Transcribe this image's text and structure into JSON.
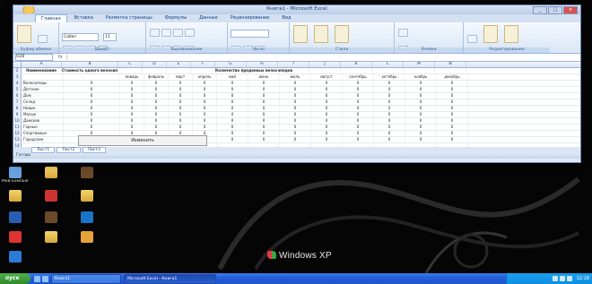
{
  "excel": {
    "title": "Книга1 - Microsoft Excel",
    "tabs": [
      "Главная",
      "Вставка",
      "Разметка страницы",
      "Формулы",
      "Данные",
      "Рецензирование",
      "Вид"
    ],
    "ribbon_groups": [
      "Буфер обмена",
      "Шрифт",
      "Выравнивание",
      "Число",
      "Стили",
      "Ячейки",
      "Редактирование"
    ],
    "font_name": "Calibri",
    "font_size": "11",
    "name_box": "O28",
    "fx": "fx",
    "columns": [
      "A",
      "B",
      "C",
      "D",
      "E",
      "F",
      "G",
      "H",
      "I",
      "J",
      "K",
      "L",
      "M",
      "N"
    ],
    "header_row": {
      "col_a": "Наименование",
      "col_b": "Стоимость одного велосипеда",
      "col_g": "Количество проданных велосипедов"
    },
    "subheaders": [
      "январь",
      "февраль",
      "март",
      "апрель",
      "май",
      "июнь",
      "июль",
      "август",
      "сентябрь",
      "октябрь",
      "ноябрь",
      "декабрь"
    ],
    "rows": [
      {
        "n": "2",
        "name": "",
        "cells": []
      },
      {
        "n": "3",
        "name": "Наименование",
        "cells": []
      },
      {
        "n": "4",
        "name": "Велосипеды",
        "cells": [
          "0",
          "0",
          "0",
          "0",
          "0",
          "0",
          "0",
          "0",
          "0",
          "0",
          "0",
          "0",
          "0"
        ]
      },
      {
        "n": "5",
        "name": "Детские",
        "cells": [
          "0",
          "0",
          "0",
          "0",
          "0",
          "0",
          "0",
          "0",
          "0",
          "0",
          "0",
          "0",
          "0"
        ]
      },
      {
        "n": "6",
        "name": "Дом",
        "cells": [
          "0",
          "0",
          "0",
          "0",
          "0",
          "0",
          "0",
          "0",
          "0",
          "0",
          "0",
          "0",
          "0"
        ]
      },
      {
        "n": "7",
        "name": "Склад",
        "cells": [
          "0",
          "0",
          "0",
          "0",
          "0",
          "0",
          "0",
          "0",
          "0",
          "0",
          "0",
          "0",
          "0"
        ]
      },
      {
        "n": "8",
        "name": "Новые",
        "cells": [
          "0",
          "0",
          "0",
          "0",
          "0",
          "0",
          "0",
          "0",
          "0",
          "0",
          "0",
          "0",
          "0"
        ]
      },
      {
        "n": "9",
        "name": "Малые",
        "cells": [
          "0",
          "0",
          "0",
          "0",
          "0",
          "0",
          "0",
          "0",
          "0",
          "0",
          "0",
          "0",
          "0"
        ]
      },
      {
        "n": "10",
        "name": "Дамские",
        "cells": [
          "0",
          "0",
          "0",
          "0",
          "0",
          "0",
          "0",
          "0",
          "0",
          "0",
          "0",
          "0",
          "0"
        ]
      },
      {
        "n": "11",
        "name": "Горные",
        "cells": [
          "0",
          "0",
          "0",
          "0",
          "0",
          "0",
          "0",
          "0",
          "0",
          "0",
          "0",
          "0",
          "0"
        ]
      },
      {
        "n": "12",
        "name": "Спортивные",
        "cells": [
          "0",
          "0",
          "0",
          "0",
          "0",
          "0",
          "0",
          "0",
          "0",
          "0",
          "0",
          "0",
          "0"
        ]
      },
      {
        "n": "13",
        "name": "Городские",
        "cells": [
          "0",
          "0",
          "0",
          "0",
          "0",
          "0",
          "0",
          "0",
          "0",
          "0",
          "0",
          "0",
          "0"
        ]
      },
      {
        "n": "14",
        "name": "",
        "cells": []
      },
      {
        "n": "15",
        "name": "",
        "cells": []
      },
      {
        "n": "16",
        "name": "",
        "cells": []
      },
      {
        "n": "17",
        "name": "",
        "cells": []
      }
    ],
    "popup": "Изменить",
    "sheet_tabs": [
      "Лист1",
      "Лист2",
      "Лист3"
    ],
    "status": "Готово"
  },
  "desktop_icons": [
    {
      "label": "Мой компьютер",
      "color": "#6aa0e0"
    },
    {
      "label": "",
      "color": "folder"
    },
    {
      "label": "",
      "color": "#6b4a2a"
    },
    {
      "label": "",
      "color": "folder"
    },
    {
      "label": "",
      "color": "#c33"
    },
    {
      "label": "",
      "color": "folder"
    },
    {
      "label": "",
      "color": "#2a5db0"
    },
    {
      "label": "",
      "color": "#6b4a2a"
    },
    {
      "label": "",
      "color": "#1a73c9"
    },
    {
      "label": "",
      "color": "#d33"
    },
    {
      "label": "",
      "color": "folder"
    },
    {
      "label": "",
      "color": "#e8a23a"
    },
    {
      "label": "",
      "color": "#2b7bd8"
    }
  ],
  "xp_label": "Windows XP",
  "taskbar": {
    "start": "пуск",
    "buttons": [
      "Книга1",
      "Microsoft Excel - Книга1"
    ],
    "clock": "12:18"
  }
}
